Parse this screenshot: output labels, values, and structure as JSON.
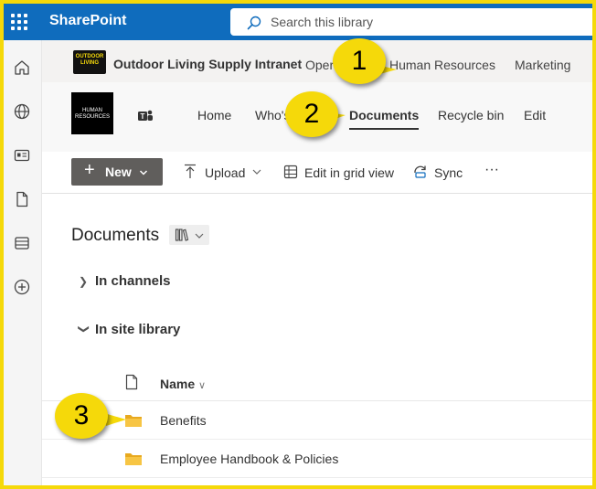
{
  "suite": {
    "app_name": "SharePoint",
    "search_placeholder": "Search this library"
  },
  "hub": {
    "logo_text": "OUTDOOR LIVING",
    "site_name": "Outdoor Living Supply Intranet",
    "links": [
      "Oper",
      "Human Resources",
      "Marketing"
    ]
  },
  "site": {
    "logo_text": "HUMAN RESOURCES",
    "nav": [
      "Home",
      "Who's",
      "Documents",
      "Recycle bin",
      "Edit"
    ],
    "active_nav": "Documents"
  },
  "commands": {
    "new_label": "New",
    "upload_label": "Upload",
    "grid_label": "Edit in grid view",
    "sync_label": "Sync",
    "more_label": "···"
  },
  "library": {
    "title": "Documents",
    "sections": [
      {
        "label": "In channels",
        "expanded": false
      },
      {
        "label": "In site library",
        "expanded": true
      }
    ],
    "column_name": "Name",
    "items": [
      "Benefits",
      "Employee Handbook & Policies"
    ]
  },
  "callouts": [
    "1",
    "2",
    "3"
  ],
  "colors": {
    "accent_blue": "#0f6cbd",
    "callout_yellow": "#f5d90a",
    "folder_yellow": "#f4b82c"
  }
}
